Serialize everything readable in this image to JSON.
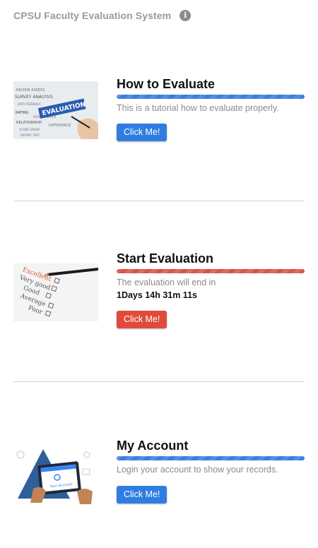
{
  "header": {
    "title": "CPSU Faculty Evaluation System",
    "info_icon": "info-icon"
  },
  "sections": [
    {
      "title": "How to Evaluate",
      "description": "This is a tutorial how to evaluate properly.",
      "button_label": "Click Me!",
      "image_text": "EVALUATION",
      "bar_color": "#4a88e4",
      "button_color": "#2f7de1"
    },
    {
      "title": "Start Evaluation",
      "description": "The evaluation will end in",
      "countdown": "1Days 14h 31m 11s",
      "button_label": "Click Me!",
      "image_items": [
        "Excellent",
        "Very good",
        "Good",
        "Average",
        "Poor"
      ],
      "bar_color": "#dc5d4f",
      "button_color": "#e04a3b"
    },
    {
      "title": "My Account",
      "description": "Login your account to show your records.",
      "button_label": "Click Me!",
      "image_text": "Your Account",
      "bar_color": "#4a88e4",
      "button_color": "#2f7de1"
    }
  ]
}
